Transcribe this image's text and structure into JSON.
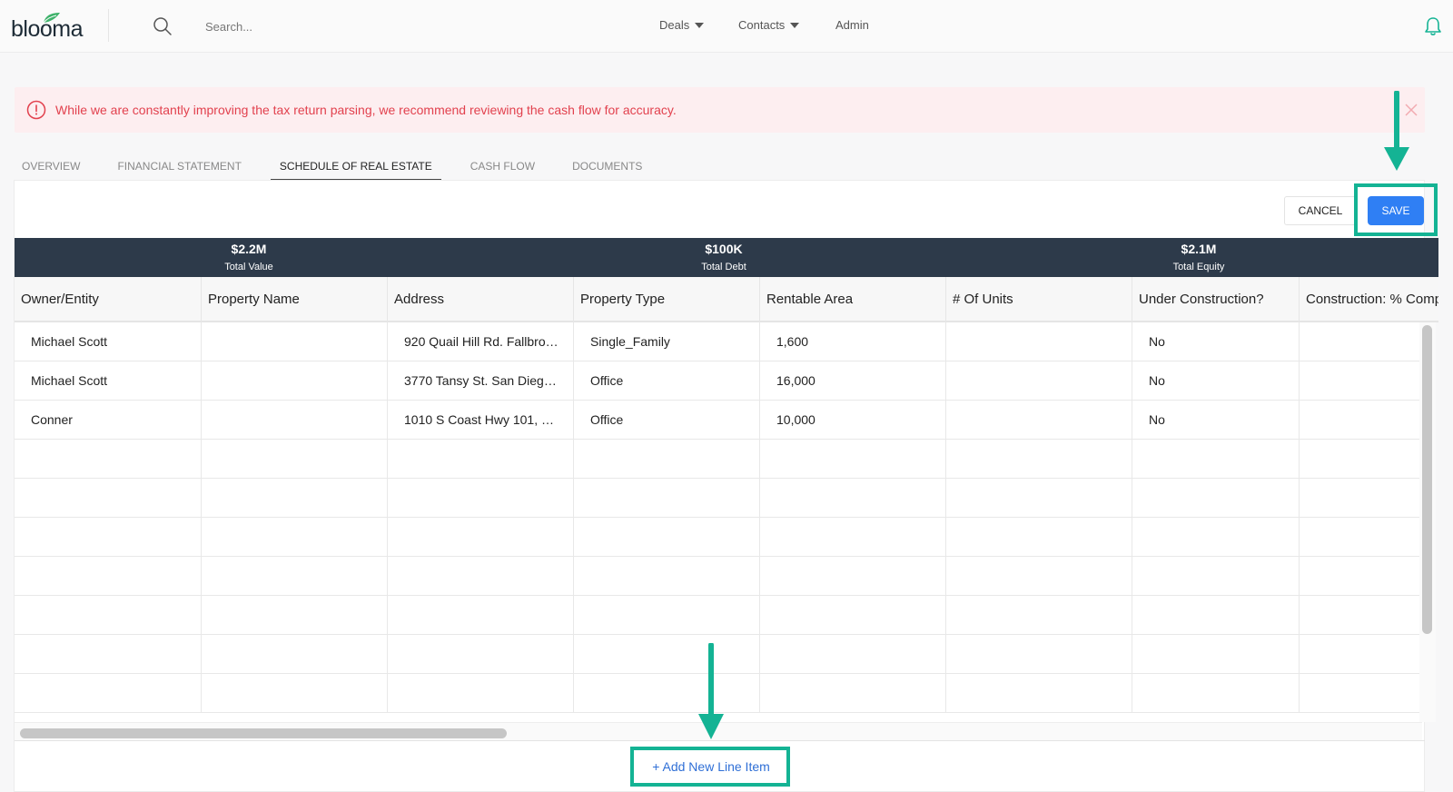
{
  "app": {
    "logo_text": "blooma"
  },
  "header": {
    "search_placeholder": "Search...",
    "nav": [
      {
        "label": "Deals",
        "has_dropdown": true
      },
      {
        "label": "Contacts",
        "has_dropdown": true
      },
      {
        "label": "Admin",
        "has_dropdown": false
      }
    ],
    "icons": {
      "search": "search-icon",
      "notifications": "bell-icon"
    }
  },
  "alert": {
    "message": "While we are constantly improving the tax return parsing, we recommend reviewing the cash flow for accuracy.",
    "color": "#e2414e",
    "background": "#fdeef0"
  },
  "tabs": [
    {
      "label": "OVERVIEW",
      "active": false
    },
    {
      "label": "FINANCIAL STATEMENT",
      "active": false
    },
    {
      "label": "SCHEDULE OF REAL ESTATE",
      "active": true
    },
    {
      "label": "CASH FLOW",
      "active": false
    },
    {
      "label": "DOCUMENTS",
      "active": false
    }
  ],
  "actions": {
    "cancel_label": "CANCEL",
    "save_label": "SAVE"
  },
  "summary": [
    {
      "value": "$2.2M",
      "label": "Total Value"
    },
    {
      "value": "$100K",
      "label": "Total Debt"
    },
    {
      "value": "$2.1M",
      "label": "Total Equity"
    }
  ],
  "table": {
    "columns": [
      "Owner/Entity",
      "Property Name",
      "Address",
      "Property Type",
      "Rentable Area",
      "# Of Units",
      "Under Construction?",
      "Construction: % Comp"
    ],
    "rows": [
      [
        "Michael Scott",
        "",
        "920 Quail Hill Rd. Fallbro…",
        "Single_Family",
        "1,600",
        "",
        "No",
        ""
      ],
      [
        "Michael Scott",
        "",
        "3770 Tansy St. San Dieg…",
        "Office",
        "16,000",
        "",
        "No",
        ""
      ],
      [
        "Conner",
        "",
        "1010 S Coast Hwy 101, …",
        "Office",
        "10,000",
        "",
        "No",
        ""
      ],
      [
        "",
        "",
        "",
        "",
        "",
        "",
        "",
        ""
      ],
      [
        "",
        "",
        "",
        "",
        "",
        "",
        "",
        ""
      ],
      [
        "",
        "",
        "",
        "",
        "",
        "",
        "",
        ""
      ],
      [
        "",
        "",
        "",
        "",
        "",
        "",
        "",
        ""
      ],
      [
        "",
        "",
        "",
        "",
        "",
        "",
        "",
        ""
      ],
      [
        "",
        "",
        "",
        "",
        "",
        "",
        "",
        ""
      ],
      [
        "",
        "",
        "",
        "",
        "",
        "",
        "",
        ""
      ]
    ]
  },
  "add_line_item_label": "+ Add New Line Item",
  "colors": {
    "accent": "#2f7ff4",
    "highlight": "#14b394",
    "summary_band": "#2d3a4a",
    "link": "#2f6fd6"
  }
}
